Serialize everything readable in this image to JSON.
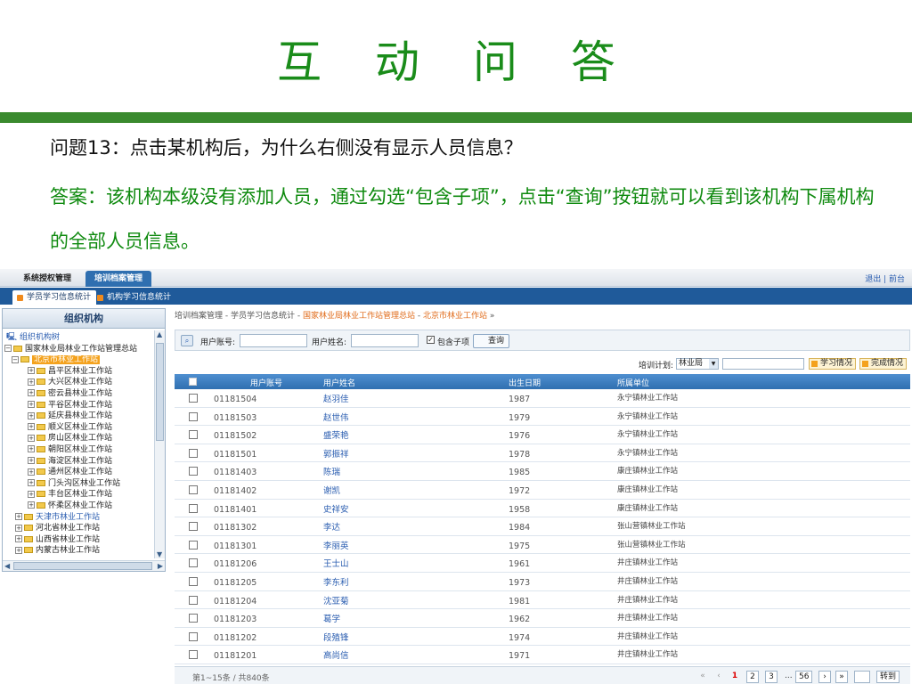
{
  "slide": {
    "title": "互 动 问 答",
    "question": "问题13：点击某机构后，为什么右侧没有显示人员信息？",
    "answer": "答案：该机构本级没有添加人员，通过勾选“包含子项”，点击“查询”按钮就可以看到该机构下属机构的全部人员信息。"
  },
  "topnav": {
    "tabs": [
      "系统授权管理",
      "培训档案管理"
    ],
    "links": "退出 | 前台"
  },
  "subnav": {
    "tabs": [
      "学员学习信息统计",
      "机构学习信息统计"
    ]
  },
  "left": {
    "title": "组织机构",
    "tree": [
      {
        "label": "组织机构树",
        "type": "root"
      },
      {
        "label": "国家林业局林业工作站管理总站",
        "toggle": "⊟"
      },
      {
        "label": "北京市林业工作站",
        "toggle": "⊟",
        "selected": true
      },
      {
        "label": "昌平区林业工作站",
        "toggle": "⊞"
      },
      {
        "label": "大兴区林业工作站",
        "toggle": "⊞"
      },
      {
        "label": "密云县林业工作站",
        "toggle": "⊞"
      },
      {
        "label": "平谷区林业工作站",
        "toggle": "⊞"
      },
      {
        "label": "延庆县林业工作站",
        "toggle": "⊞"
      },
      {
        "label": "顺义区林业工作站",
        "toggle": "⊞"
      },
      {
        "label": "房山区林业工作站",
        "toggle": "⊞"
      },
      {
        "label": "朝阳区林业工作站",
        "toggle": "⊞"
      },
      {
        "label": "海淀区林业工作站",
        "toggle": "⊞"
      },
      {
        "label": "通州区林业工作站",
        "toggle": "⊞"
      },
      {
        "label": "门头沟区林业工作站",
        "toggle": "⊞"
      },
      {
        "label": "丰台区林业工作站",
        "toggle": "⊞"
      },
      {
        "label": "怀柔区林业工作站",
        "toggle": "⊞"
      },
      {
        "label": "天津市林业工作站",
        "toggle": "⊞",
        "blue": true
      },
      {
        "label": "河北省林业工作站",
        "toggle": "⊞"
      },
      {
        "label": "山西省林业工作站",
        "toggle": "⊞"
      },
      {
        "label": "内蒙古林业工作站",
        "toggle": "⊞"
      }
    ]
  },
  "crumb": {
    "prefix": "培训档案管理 - 学员学习信息统计 - ",
    "hl1": "国家林业局林业工作站管理总站",
    "sep": " - ",
    "hl2": "北京市林业工作站",
    "suffix": " »"
  },
  "search": {
    "account_label": "用户账号:",
    "name_label": "用户姓名:",
    "include_label": "包含子项",
    "include_mark": "✓",
    "query_button": "查询"
  },
  "plan": {
    "label": "培训计划:",
    "selected": "林业局",
    "btn_study": "学习情况",
    "btn_done": "完成情况"
  },
  "table": {
    "headers": [
      "用户账号",
      "用户姓名",
      "出生日期",
      "所属单位"
    ],
    "rows": [
      {
        "id": "01181504",
        "name": "赵羽佳",
        "year": "1987",
        "unit": "永宁镇林业工作站"
      },
      {
        "id": "01181503",
        "name": "赵世伟",
        "year": "1979",
        "unit": "永宁镇林业工作站"
      },
      {
        "id": "01181502",
        "name": "盛荣艳",
        "year": "1976",
        "unit": "永宁镇林业工作站"
      },
      {
        "id": "01181501",
        "name": "郭振祥",
        "year": "1978",
        "unit": "永宁镇林业工作站"
      },
      {
        "id": "01181403",
        "name": "陈瑞",
        "year": "1985",
        "unit": "康庄镇林业工作站"
      },
      {
        "id": "01181402",
        "name": "谢凯",
        "year": "1972",
        "unit": "康庄镇林业工作站"
      },
      {
        "id": "01181401",
        "name": "史祥安",
        "year": "1958",
        "unit": "康庄镇林业工作站"
      },
      {
        "id": "01181302",
        "name": "李达",
        "year": "1984",
        "unit": "张山营镇林业工作站"
      },
      {
        "id": "01181301",
        "name": "李丽英",
        "year": "1975",
        "unit": "张山营镇林业工作站"
      },
      {
        "id": "01181206",
        "name": "王士山",
        "year": "1961",
        "unit": "井庄镇林业工作站"
      },
      {
        "id": "01181205",
        "name": "李东利",
        "year": "1973",
        "unit": "井庄镇林业工作站"
      },
      {
        "id": "01181204",
        "name": "沈亚菊",
        "year": "1981",
        "unit": "井庄镇林业工作站"
      },
      {
        "id": "01181203",
        "name": "葛学",
        "year": "1962",
        "unit": "井庄镇林业工作站"
      },
      {
        "id": "01181202",
        "name": "段殖锋",
        "year": "1974",
        "unit": "井庄镇林业工作站"
      },
      {
        "id": "01181201",
        "name": "高尚信",
        "year": "1971",
        "unit": "井庄镇林业工作站"
      }
    ]
  },
  "pager": {
    "summary": "第1~15条 / 共840条",
    "first": "«",
    "prev": "‹",
    "pages": [
      "1",
      "2",
      "3"
    ],
    "ellipsis": "...",
    "last_page": "56",
    "next": "›",
    "end": "»",
    "go": "转到"
  }
}
